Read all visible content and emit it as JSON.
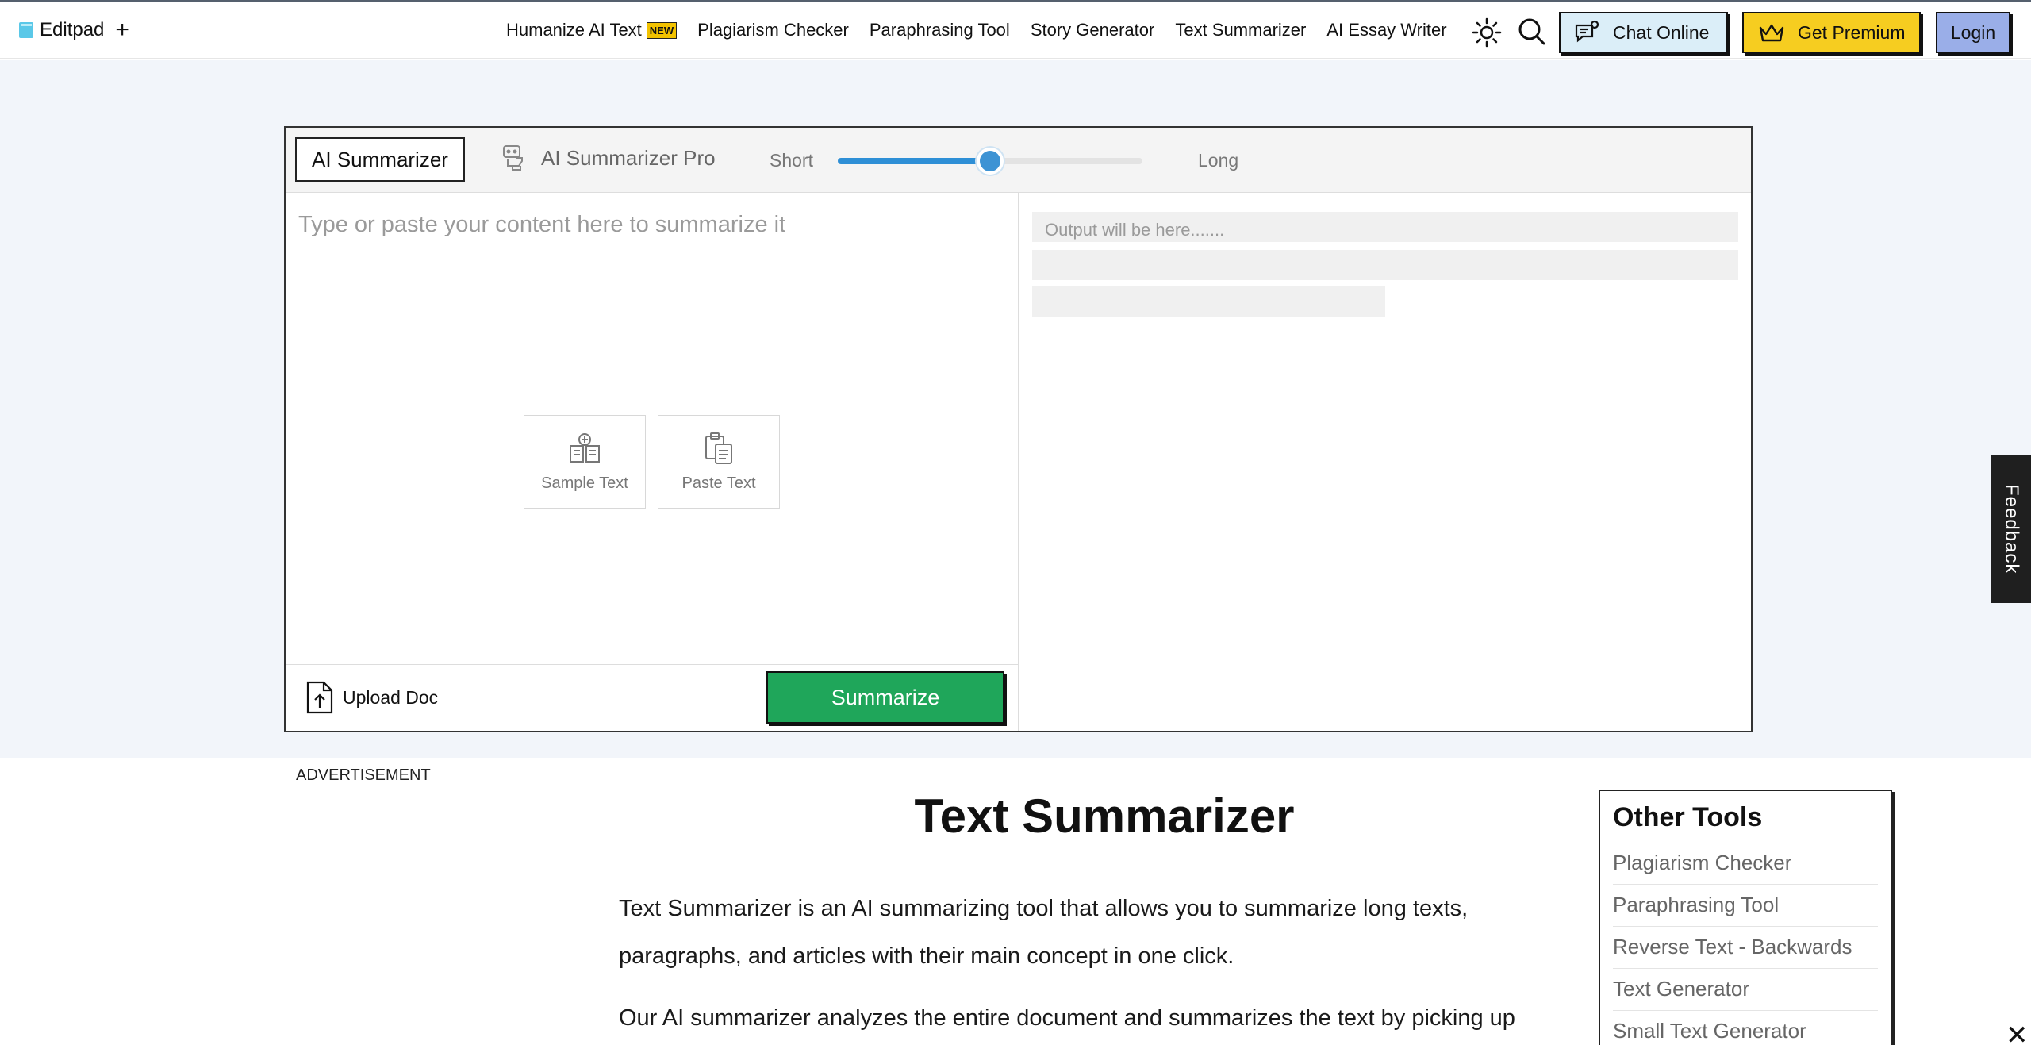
{
  "header": {
    "logo_text": "Editpad",
    "logo_plus": "+",
    "nav": [
      {
        "label": "Humanize AI Text",
        "badge": "NEW"
      },
      {
        "label": "Plagiarism Checker"
      },
      {
        "label": "Paraphrasing Tool"
      },
      {
        "label": "Story Generator"
      },
      {
        "label": "Text Summarizer"
      },
      {
        "label": "AI Essay Writer"
      }
    ],
    "chat_label": "Chat Online",
    "premium_label": "Get Premium",
    "login_label": "Login"
  },
  "tool": {
    "tab_basic": "AI Summarizer",
    "tab_pro": "AI Summarizer Pro",
    "length_short": "Short",
    "length_long": "Long",
    "length_value": 0.5,
    "input_placeholder": "Type or paste your content here to summarize it",
    "sample_text_label": "Sample Text",
    "paste_text_label": "Paste Text",
    "upload_label": "Upload Doc",
    "summarize_label": "Summarize",
    "output_placeholder": "Output will be here......."
  },
  "feedback_label": "Feedback",
  "content": {
    "ad_label": "ADVERTISEMENT",
    "title": "Text Summarizer",
    "paragraph1": "Text Summarizer is an AI summarizing tool that allows you to summarize long texts, paragraphs, and articles with their main concept in one click.",
    "paragraph2": "Our AI summarizer analyzes the entire document and summarizes the text by picking up"
  },
  "other_tools": {
    "title": "Other Tools",
    "items": [
      "Plagiarism Checker",
      "Paraphrasing Tool",
      "Reverse Text - Backwards",
      "Text Generator",
      "Small Text Generator"
    ]
  },
  "colors": {
    "accent_blue": "#3d93d4",
    "summarize_green": "#1fa65a",
    "premium_yellow": "#f6cd20",
    "chat_blue": "#dbeef8",
    "login_blue": "#9aaee8",
    "band_bg": "#f2f5fa"
  },
  "icons": [
    "logo-icon",
    "sun-icon",
    "search-icon",
    "chat-icon",
    "crown-icon",
    "robot-hand-icon",
    "sample-doc-icon",
    "clipboard-icon",
    "upload-icon",
    "close-icon"
  ]
}
